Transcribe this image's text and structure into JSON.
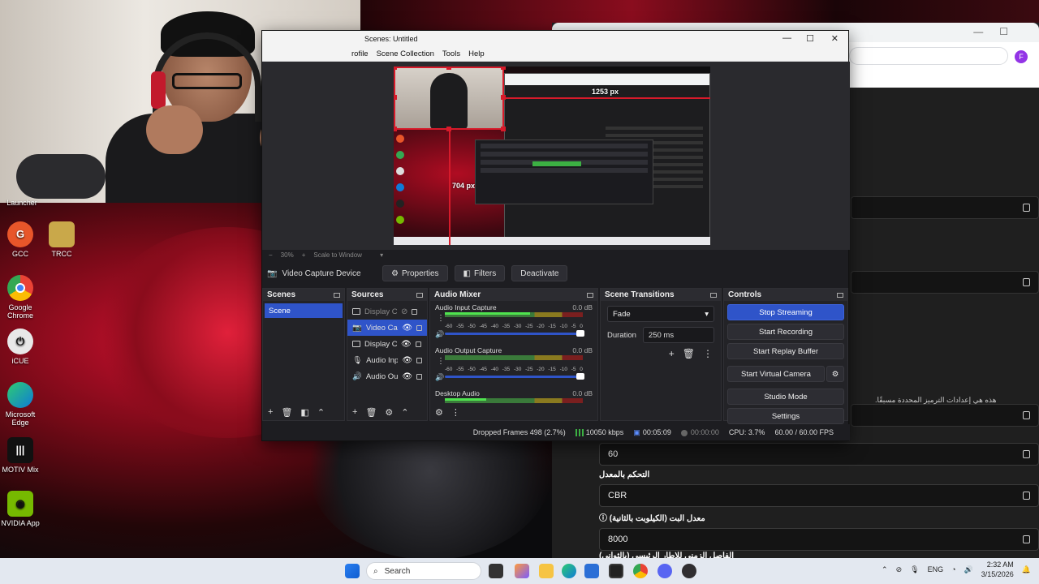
{
  "desktop": {
    "icons": [
      {
        "label": "Launcher",
        "icon": "launcher-icon",
        "color": "#2a2a2a"
      },
      {
        "label": "GCC",
        "icon": "gcc-icon",
        "color": "#e8562a"
      },
      {
        "label": "TRCC",
        "icon": "trcc-icon",
        "color": "#c9a84a"
      },
      {
        "label": "Google Chrome",
        "icon": "chrome-icon",
        "color": "#34a853"
      },
      {
        "label": "iCUE",
        "icon": "icue-icon",
        "color": "#e2e2e2"
      },
      {
        "label": "Microsoft Edge",
        "icon": "edge-icon",
        "color": "#0f7bd8"
      },
      {
        "label": "MOTIV Mix",
        "icon": "motiv-icon",
        "color": "#111111"
      },
      {
        "label": "NVIDIA App",
        "icon": "nvidia-icon",
        "color": "#76b900"
      }
    ]
  },
  "browser": {
    "profile_initial": "F",
    "rtl_note": "هذه هي إعدادات الترميز المحددة مسبقًا.",
    "fields": [
      {
        "label": "",
        "value": "60"
      },
      {
        "label": "التحكم بالمعدل",
        "value": "CBR"
      },
      {
        "label": "معدل البت (الكيلوبت بالثانية)",
        "value": "8000"
      }
    ],
    "bottom_label": "الفاصل الزمني للإطار الرئيسي (بالثواني)"
  },
  "obs": {
    "title": "Scenes: Untitled",
    "menu": [
      "rofile",
      "Scene Collection",
      "Tools",
      "Help"
    ],
    "preview": {
      "width_label": "1253 px",
      "height_label": "704 px"
    },
    "zoom": {
      "minus": "−",
      "value": "30%",
      "plus": "+",
      "mode": "Scale to Window"
    },
    "source_bar": {
      "current_source": "Video Capture Device",
      "properties": "Properties",
      "filters": "Filters",
      "deactivate": "Deactivate"
    },
    "scenes": {
      "title": "Scenes",
      "items": [
        "Scene"
      ]
    },
    "sources": {
      "title": "Sources",
      "items": [
        {
          "name": "Display Ca",
          "icon": "monitor-icon",
          "visible": false,
          "selected": false
        },
        {
          "name": "Video Cap",
          "icon": "camera-icon",
          "visible": true,
          "selected": true
        },
        {
          "name": "Display Ca",
          "icon": "monitor-icon",
          "visible": true,
          "selected": false
        },
        {
          "name": "Audio Inp",
          "icon": "microphone-icon",
          "visible": true,
          "selected": false
        },
        {
          "name": "Audio Out",
          "icon": "speaker-icon",
          "visible": true,
          "selected": false
        }
      ]
    },
    "mixer": {
      "title": "Audio Mixer",
      "scale": [
        "-60",
        "-55",
        "-50",
        "-45",
        "-40",
        "-35",
        "-30",
        "-25",
        "-20",
        "-15",
        "-10",
        "-5",
        "0"
      ],
      "channels": [
        {
          "name": "Audio Input Capture",
          "db": "0.0 dB",
          "level": 0.62
        },
        {
          "name": "Audio Output Capture",
          "db": "0.0 dB",
          "level": 0.0
        },
        {
          "name": "Desktop Audio",
          "db": "0.0 dB",
          "level": 0.3
        }
      ]
    },
    "transitions": {
      "title": "Scene Transitions",
      "selected": "Fade",
      "duration_label": "Duration",
      "duration_value": "250 ms"
    },
    "controls": {
      "title": "Controls",
      "buttons": [
        "Stop Streaming",
        "Start Recording",
        "Start Replay Buffer",
        "Start Virtual Camera",
        "Studio Mode",
        "Settings"
      ]
    },
    "status": {
      "dropped": "Dropped Frames 498 (2.7%)",
      "bitrate": "10050 kbps",
      "stream_time": "00:05:09",
      "rec_time": "00:00:00",
      "cpu": "CPU: 3.7%",
      "fps": "60.00 / 60.00 FPS"
    }
  },
  "taskbar": {
    "search_placeholder": "Search",
    "lang": "ENG",
    "time": "2:32 AM",
    "date": "3/15/2026"
  },
  "colors": {
    "accent": "#2f54c9",
    "obs_bg": "#1d1d21",
    "selection": "#d71a2a"
  }
}
